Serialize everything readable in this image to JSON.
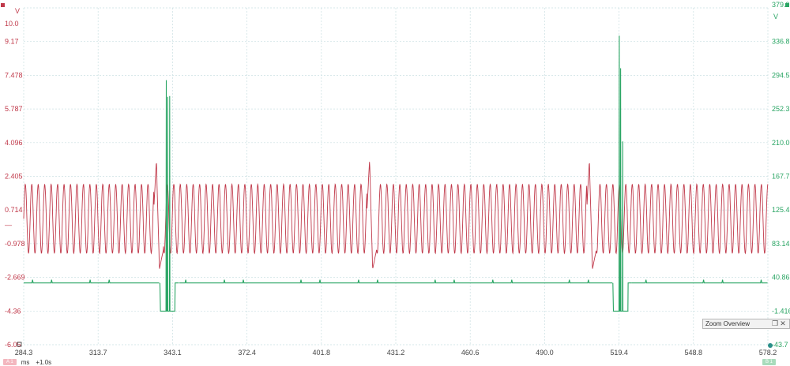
{
  "chart_data": {
    "type": "line",
    "x": {
      "ticks": [
        "284.3",
        "313.7",
        "343.1",
        "372.4",
        "401.8",
        "431.2",
        "460.6",
        "490.0",
        "519.4",
        "548.8",
        "578.2"
      ],
      "range": [
        284.3,
        578.2
      ],
      "unit": "ms"
    },
    "y_left": {
      "unit": "V",
      "range": [
        -6.05,
        10.0
      ],
      "ticks": [
        "10.0",
        "9.17",
        "7.478",
        "5.787",
        "4.096",
        "2.405",
        "0.714",
        "-0.978",
        "-2.669",
        "-4.36",
        "-6.05"
      ],
      "color": "#c0394a"
    },
    "y_right": {
      "unit": "V",
      "range": [
        -43.7,
        379.9
      ],
      "ticks": [
        "379.9",
        "336.8",
        "294.5",
        "252.3",
        "210.0",
        "167.7",
        "125.4",
        "83.14",
        "40.86",
        "-1.416",
        "-43.7"
      ],
      "color": "#2aa564"
    },
    "series": [
      {
        "axis": "left",
        "color": "#c0394a",
        "shape": "sine",
        "high": 1.6,
        "low": -1.7,
        "period_ms": 2.55,
        "events": [
          {
            "x": 337.3,
            "pre_peak": 2.75,
            "dip": -2.45
          },
          {
            "x": 421.5,
            "pre_peak": 2.75,
            "dip": -2.45
          },
          {
            "x": 508.3,
            "pre_peak": 2.75,
            "dip": -2.45
          }
        ]
      },
      {
        "axis": "right",
        "color": "#2aa564",
        "shape": "baseline-with-spikes",
        "baseline": 34.0,
        "spikes": [
          {
            "x": 340.6,
            "peaks": [
              289,
              268,
              269
            ],
            "low": -1.4,
            "width_ms": 5.0
          },
          {
            "x": 519.5,
            "peaks": [
              345,
              304,
              212
            ],
            "low": -1.4,
            "width_ms": 5.0
          }
        ]
      }
    ],
    "grid": true,
    "legend": "none"
  },
  "marker_left": "—",
  "overview": {
    "title": "Zoom Overview",
    "restore_icon": "restore-window-icon",
    "close_icon": "close-icon"
  },
  "status": {
    "left_badge": "A 1",
    "x_unit": "ms",
    "time_offset": "+1.0s",
    "right_badge": "B 1"
  }
}
